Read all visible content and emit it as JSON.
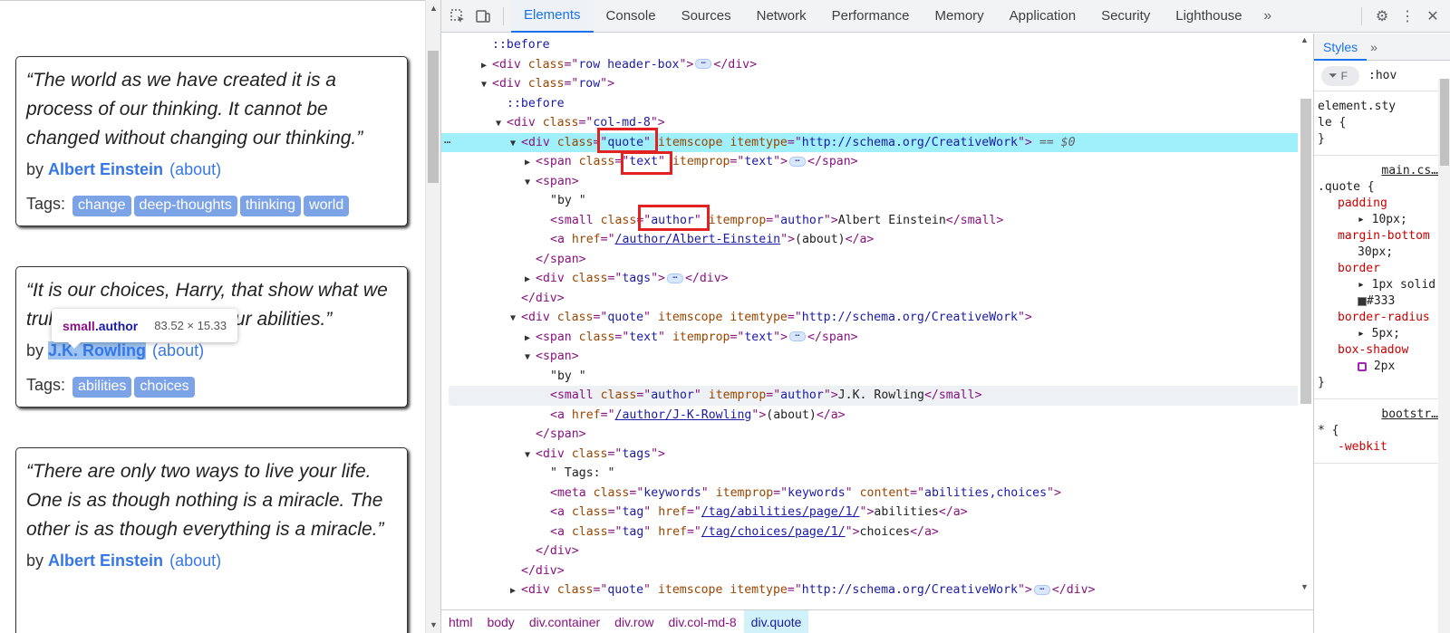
{
  "page": {
    "quotes": [
      {
        "text": "“The world as we have created it is a process of our thinking. It cannot be changed without changing our thinking.”",
        "by": "by",
        "author": "Albert Einstein",
        "about": "(about)",
        "tags_label": "Tags:",
        "tags": [
          "change",
          "deep-thoughts",
          "thinking",
          "world"
        ]
      },
      {
        "text": "“It is our choices, Harry, that show what we truly are, far more than our abilities.”",
        "by": "by",
        "author": "J.K. Rowling",
        "about": "(about)",
        "tags_label": "Tags:",
        "tags": [
          "abilities",
          "choices"
        ]
      },
      {
        "text": "“There are only two ways to live your life. One is as though nothing is a miracle. The other is as though everything is a miracle.”",
        "by": "by",
        "author": "Albert Einstein",
        "about": "(about)"
      }
    ],
    "tooltip": {
      "tag": "small",
      "cls": ".author",
      "dims": "83.52 × 15.33"
    }
  },
  "devtools": {
    "tabs": [
      "Elements",
      "Console",
      "Sources",
      "Network",
      "Performance",
      "Memory",
      "Application",
      "Security",
      "Lighthouse"
    ],
    "active_tab": "Elements",
    "breadcrumbs": [
      "html",
      "body",
      "div.container",
      "div.row",
      "div.col-md-8",
      "div.quote"
    ],
    "selected_marker": "== $0",
    "styles": {
      "tab": "Styles",
      "filter_placeholder": "F",
      "hov": ":hov",
      "element_style": [
        "element.sty",
        "le {",
        "}"
      ],
      "rule1": {
        "source": "main.cs…",
        "selector": ".quote {",
        "lines": [
          {
            "p": "padding",
            "v": [
              "10px;"
            ]
          },
          {
            "p": "margin-bottom",
            "v": [
              "30px;"
            ]
          },
          {
            "p": "border",
            "v": [
              "1px",
              "solid",
              "#333"
            ]
          },
          {
            "p": "border-radius",
            "v": [
              "5px;"
            ]
          },
          {
            "p": "box-shadow",
            "v": [
              "2px"
            ]
          }
        ],
        "close": "}"
      },
      "rule2": {
        "source": "bootstr…",
        "selector": "* {",
        "prop": "-webkit"
      }
    },
    "dom": {
      "l01": "::before",
      "l02": {
        "tag": "div",
        "attr": "class",
        "val": "row header-box"
      },
      "l03": {
        "tag": "div",
        "attr": "class",
        "val": "row"
      },
      "l04": "::before",
      "l05": {
        "tag": "div",
        "attr": "class",
        "val": "col-md-8"
      },
      "l06": {
        "tag": "div",
        "attr": "class",
        "val": "quote",
        "a2": "itemscope",
        "a3": "itemtype",
        "v3": "http://schema.org/CreativeWork"
      },
      "l07": {
        "tag": "span",
        "attr": "class",
        "val": "text",
        "a2": "itemprop",
        "v2": "text"
      },
      "l08": "span",
      "l09": "\"by \"",
      "l10": {
        "tag": "small",
        "attr": "class",
        "val": "author",
        "a2": "itemprop",
        "v2": "author",
        "text": "Albert Einstein"
      },
      "l11": {
        "tag": "a",
        "attr": "href",
        "val": "/author/Albert-Einstein",
        "text": "(about)"
      },
      "l12": "span",
      "l13": {
        "tag": "div",
        "attr": "class",
        "val": "tags"
      },
      "l14": "div",
      "l15": {
        "tag": "div",
        "attr": "class",
        "val": "quote",
        "a2": "itemscope",
        "a3": "itemtype",
        "v3": "http://schema.org/CreativeWork"
      },
      "l16": {
        "tag": "span",
        "attr": "class",
        "val": "text",
        "a2": "itemprop",
        "v2": "text"
      },
      "l17": "span",
      "l18": "\"by \"",
      "l19": {
        "tag": "small",
        "attr": "class",
        "val": "author",
        "a2": "itemprop",
        "v2": "author",
        "text": "J.K. Rowling"
      },
      "l20": {
        "tag": "a",
        "attr": "href",
        "val": "/author/J-K-Rowling",
        "text": "(about)"
      },
      "l21": "span",
      "l22": {
        "tag": "div",
        "attr": "class",
        "val": "tags"
      },
      "l23": "\" Tags: \"",
      "l24": {
        "tag": "meta",
        "attr": "class",
        "val": "keywords",
        "a2": "itemprop",
        "v2": "keywords",
        "a3": "content",
        "v3": "abilities,choices"
      },
      "l25": {
        "tag": "a",
        "attr": "class",
        "val": "tag",
        "a2": "href",
        "v2": "/tag/abilities/page/1/",
        "text": "abilities"
      },
      "l26": {
        "tag": "a",
        "attr": "class",
        "val": "tag",
        "a2": "href",
        "v2": "/tag/choices/page/1/",
        "text": "choices"
      },
      "l27": "div",
      "l28": "div",
      "l29": {
        "tag": "div",
        "attr": "class",
        "val": "quote",
        "a2": "itemscope",
        "a3": "itemtype",
        "v3": "http://schema.org/CreativeWork"
      }
    }
  }
}
